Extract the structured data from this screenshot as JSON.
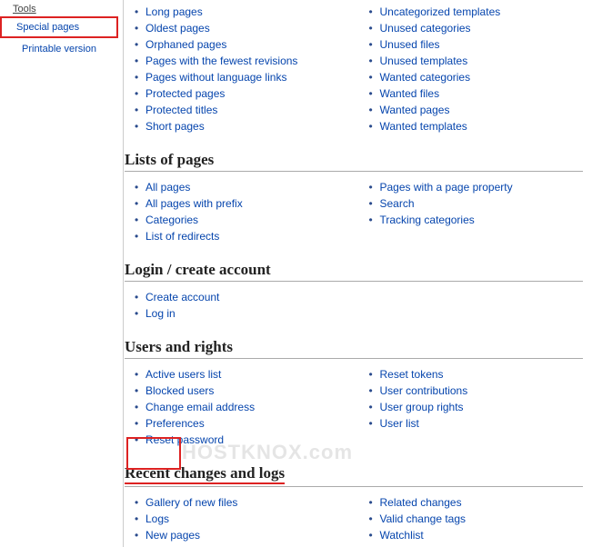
{
  "sidebar": {
    "tools_heading": "Tools",
    "special_pages": "Special pages",
    "printable_version": "Printable version"
  },
  "maintenance": {
    "left": [
      "Long pages",
      "Oldest pages",
      "Orphaned pages",
      "Pages with the fewest revisions",
      "Pages without language links",
      "Protected pages",
      "Protected titles",
      "Short pages"
    ],
    "right": [
      "Uncategorized templates",
      "Unused categories",
      "Unused files",
      "Unused templates",
      "Wanted categories",
      "Wanted files",
      "Wanted pages",
      "Wanted templates"
    ]
  },
  "lists_of_pages": {
    "heading": "Lists of pages",
    "left": [
      "All pages",
      "All pages with prefix",
      "Categories",
      "List of redirects"
    ],
    "right": [
      "Pages with a page property",
      "Search",
      "Tracking categories"
    ]
  },
  "login_create": {
    "heading": "Login / create account",
    "left": [
      "Create account",
      "Log in"
    ]
  },
  "users_rights": {
    "heading": "Users and rights",
    "left": [
      "Active users list",
      "Blocked users",
      "Change email address",
      "Preferences",
      "Reset password"
    ],
    "right": [
      "Reset tokens",
      "User contributions",
      "User group rights",
      "User list"
    ]
  },
  "recent_changes": {
    "heading": "Recent changes and logs",
    "left": [
      "Gallery of new files",
      "Logs",
      "New pages"
    ],
    "right": [
      "Related changes",
      "Valid change tags",
      "Watchlist"
    ]
  },
  "watermark": "HOSTKNOX.com"
}
